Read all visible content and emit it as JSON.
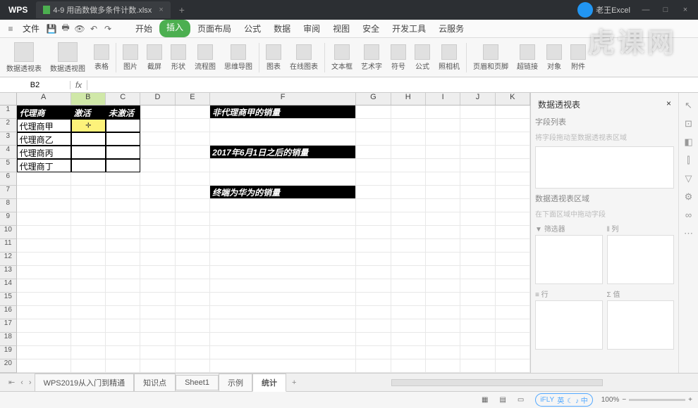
{
  "titlebar": {
    "app": "WPS",
    "doc_tab": "4-9 用函数做多条件计数.xlsx",
    "user": "老王Excel",
    "min": "—",
    "max": "□",
    "close": "×"
  },
  "menubar": {
    "file": "文件",
    "tabs": [
      "开始",
      "插入",
      "页面布局",
      "公式",
      "数据",
      "审阅",
      "视图",
      "安全",
      "开发工具",
      "云服务"
    ],
    "active_index": 1
  },
  "ribbon": {
    "items": [
      "数据透视表",
      "数据透视图",
      "表格",
      "图片",
      "截屏",
      "形状",
      "流程图",
      "思维导图",
      "图表",
      "在线图表",
      "文本框",
      "艺术字",
      "符号",
      "公式",
      "照相机",
      "页眉和页脚",
      "超链接",
      "对象",
      "附件"
    ]
  },
  "formula": {
    "cell_ref": "B2",
    "fx": "fx",
    "value": ""
  },
  "sheet": {
    "cols": [
      "A",
      "B",
      "C",
      "D",
      "E",
      "F",
      "G",
      "H",
      "I",
      "J",
      "K"
    ],
    "header_row": {
      "A": "代理商",
      "B": "激活",
      "C": "未激活"
    },
    "data_rows": [
      {
        "A": "代理商甲"
      },
      {
        "A": "代理商乙"
      },
      {
        "A": "代理商丙"
      },
      {
        "A": "代理商丁"
      }
    ],
    "f_labels": {
      "r1": "非代理商甲的销量",
      "r4": "2017年6月1日之后的销量",
      "r7": "终端为华为的销量"
    }
  },
  "side": {
    "title": "数据透视表",
    "fields_label": "字段列表",
    "fields_hint": "将字段拖动至数据透视表区域",
    "areas_label": "数据透视表区域",
    "areas_hint": "在下面区域中拖动字段",
    "filter": "筛选器",
    "col": "列",
    "row": "行",
    "val": "值"
  },
  "tabs": {
    "sheets": [
      "WPS2019从入门到精通",
      "知识点",
      "Sheet1",
      "示例",
      "统计"
    ],
    "active_index": 4
  },
  "status": {
    "ime": "英",
    "zoom": "100%",
    "ifly": "iFLY"
  },
  "watermark": "虎课网"
}
